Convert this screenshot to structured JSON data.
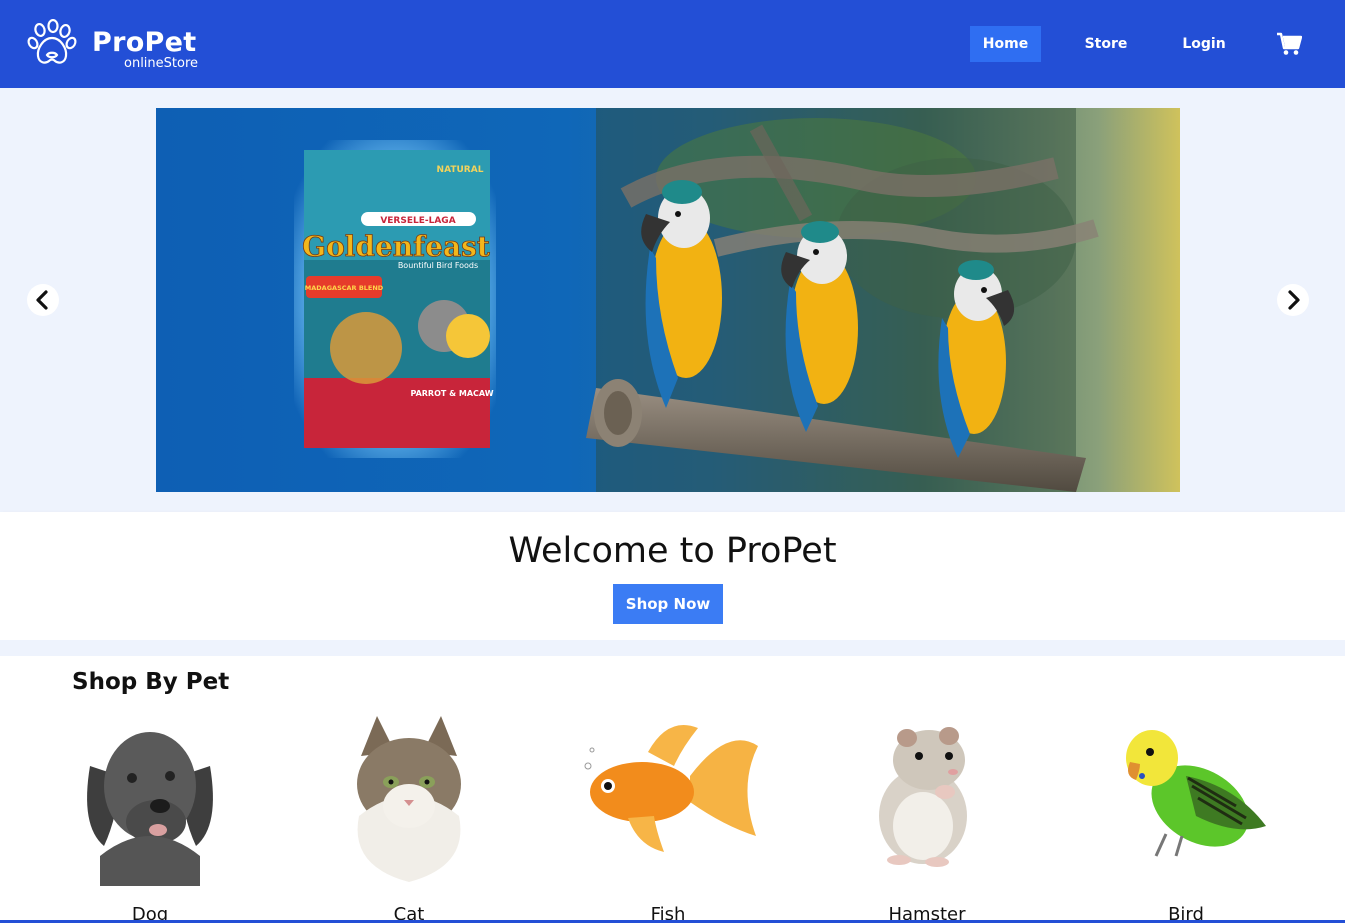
{
  "header": {
    "brand": "ProPet",
    "tagline": "onlineStore",
    "nav": [
      {
        "label": "Home",
        "active": true
      },
      {
        "label": "Store",
        "active": false
      },
      {
        "label": "Login",
        "active": false
      }
    ],
    "icons": {
      "logo": "paw-icon",
      "cart": "cart-icon"
    },
    "colors": {
      "header_bg": "#234fd6",
      "active_nav_bg": "#2f6ef2"
    }
  },
  "carousel": {
    "product": {
      "brand": "VERSELE-LAGA",
      "name": "Goldenfeast",
      "subtitle": "Bountiful Bird Foods",
      "badge": "MADAGASCAR BLEND",
      "tag": "NATURAL",
      "variant": "PARROT & MACAW"
    },
    "icons": {
      "prev": "chevron-left-icon",
      "next": "chevron-right-icon"
    }
  },
  "welcome": {
    "title": "Welcome to ProPet",
    "cta": "Shop Now",
    "cta_color": "#3b7cf4"
  },
  "shop_by_pet": {
    "title": "Shop By Pet",
    "pets": [
      {
        "label": "Dog",
        "icon": "dog-image"
      },
      {
        "label": "Cat",
        "icon": "cat-image"
      },
      {
        "label": "Fish",
        "icon": "fish-image"
      },
      {
        "label": "Hamster",
        "icon": "hamster-image"
      },
      {
        "label": "Bird",
        "icon": "bird-image"
      }
    ]
  }
}
